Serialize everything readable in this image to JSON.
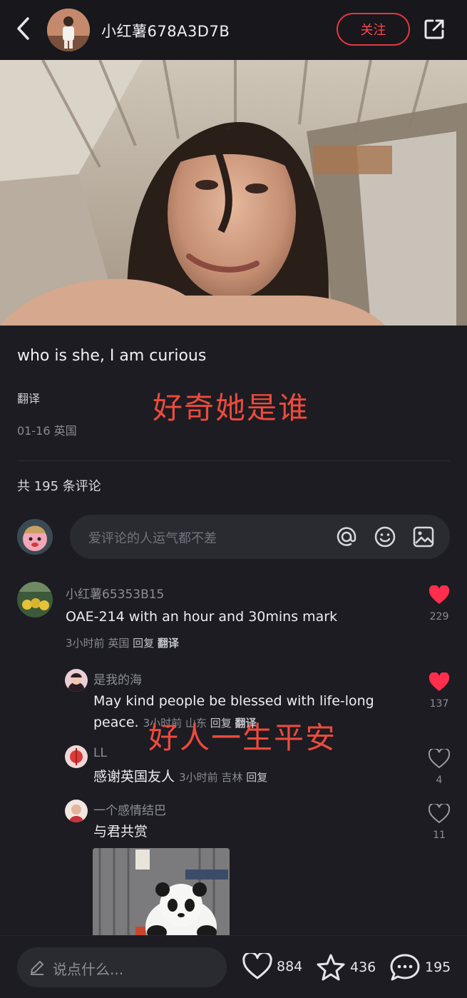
{
  "header": {
    "username": "小红薯678A3D7B",
    "follow_label": "关注"
  },
  "post": {
    "text": "who is she, I am curious",
    "translate_label": "翻译",
    "overlay_translation": "好奇她是谁",
    "date": "01-16",
    "location": "英国"
  },
  "comments_section": {
    "count_label": "共 195 条评论",
    "input_placeholder": "爱评论的人运气都不差",
    "comments": [
      {
        "name": "小红薯65353B15",
        "text": "OAE-214 with an hour and 30mins mark",
        "time": "3小时前",
        "location": "英国",
        "reply_label": "回复",
        "translate_label": "翻译",
        "likes": "229",
        "liked": true
      },
      {
        "name": "是我的海",
        "text_line1": "May kind people be blessed with life-long",
        "text_line2": "peace.",
        "time": "3小时前",
        "location": "山东",
        "reply_label": "回复",
        "translate_label": "翻译",
        "likes": "137",
        "liked": true
      },
      {
        "name": "LL",
        "text": "感谢英国友人",
        "time": "3小时前",
        "location": "吉林",
        "reply_label": "回复",
        "likes": "4",
        "liked": false
      },
      {
        "name": "一个感情结巴",
        "text": "与君共赏",
        "likes": "11",
        "liked": false
      }
    ],
    "overlay_translation_2": "好人一生平安"
  },
  "bottom_bar": {
    "placeholder": "说点什么...",
    "likes": "884",
    "favorites": "436",
    "comments": "195"
  },
  "colors": {
    "background": "#1c1c22",
    "accent_red": "#ff2e4d",
    "overlay_red": "#ec4a3c"
  },
  "icons": [
    "back-icon",
    "share-icon",
    "at-icon",
    "emoji-icon",
    "image-icon",
    "heart-icon",
    "star-icon",
    "comment-icon",
    "pencil-icon"
  ]
}
